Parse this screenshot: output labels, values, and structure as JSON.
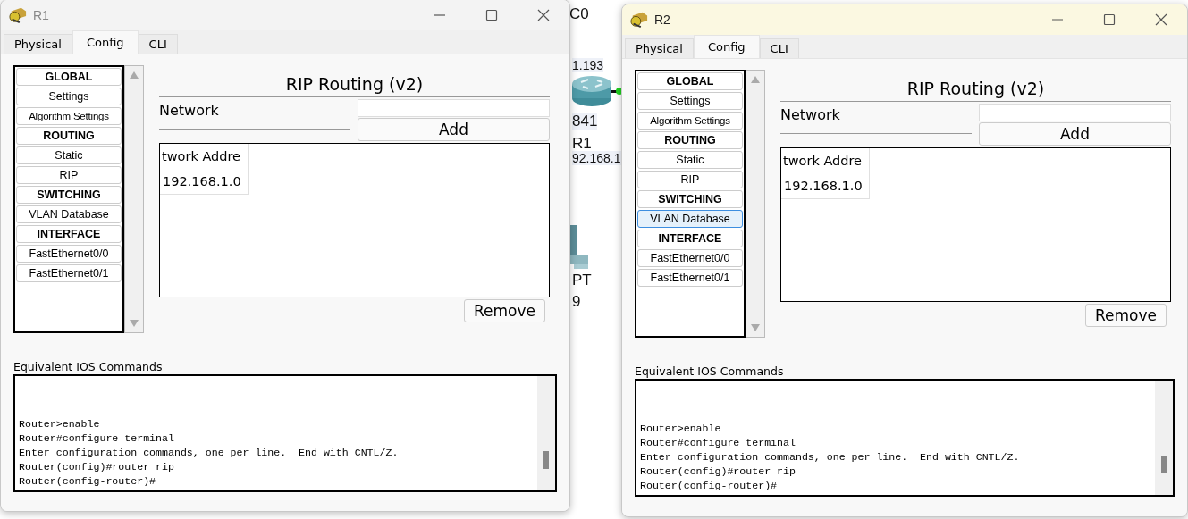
{
  "canvas_labels": [
    "C0",
    "1.193",
    "841",
    "R1",
    "92.168.1",
    "PT",
    "9"
  ],
  "windows": [
    {
      "title": "R1",
      "active": false,
      "tabs": [
        {
          "label": "Physical",
          "selected": false
        },
        {
          "label": "Config",
          "selected": true
        },
        {
          "label": "CLI",
          "selected": false
        }
      ],
      "sidebar": [
        {
          "label": "GLOBAL",
          "kind": "header",
          "selected": false
        },
        {
          "label": "Settings",
          "kind": "item",
          "selected": false
        },
        {
          "label": "Algorithm Settings",
          "kind": "item",
          "selected": false
        },
        {
          "label": "ROUTING",
          "kind": "header",
          "selected": false
        },
        {
          "label": "Static",
          "kind": "item",
          "selected": false
        },
        {
          "label": "RIP",
          "kind": "item",
          "selected": false
        },
        {
          "label": "SWITCHING",
          "kind": "header",
          "selected": false
        },
        {
          "label": "VLAN Database",
          "kind": "item",
          "selected": false
        },
        {
          "label": "INTERFACE",
          "kind": "header",
          "selected": false
        },
        {
          "label": "FastEthernet0/0",
          "kind": "item",
          "selected": false
        },
        {
          "label": "FastEthernet0/1",
          "kind": "item",
          "selected": false
        }
      ],
      "panel_title": "RIP Routing (v2)",
      "network_label": "Network",
      "add_button": "Add",
      "table": {
        "columns": [
          "twork Addre"
        ],
        "rows": [
          [
            "192.168.1.0"
          ]
        ]
      },
      "remove_button": "Remove",
      "commands_label": "Equivalent IOS Commands",
      "commands": [
        "Router>enable",
        "Router#configure terminal",
        "Enter configuration commands, one per line.  End with CNTL/Z.",
        "Router(config)#router rip",
        "Router(config-router)#"
      ]
    },
    {
      "title": "R2",
      "active": true,
      "tabs": [
        {
          "label": "Physical",
          "selected": false
        },
        {
          "label": "Config",
          "selected": true
        },
        {
          "label": "CLI",
          "selected": false
        }
      ],
      "sidebar": [
        {
          "label": "GLOBAL",
          "kind": "header",
          "selected": false
        },
        {
          "label": "Settings",
          "kind": "item",
          "selected": false
        },
        {
          "label": "Algorithm Settings",
          "kind": "item",
          "selected": false
        },
        {
          "label": "ROUTING",
          "kind": "header",
          "selected": false
        },
        {
          "label": "Static",
          "kind": "item",
          "selected": false
        },
        {
          "label": "RIP",
          "kind": "item",
          "selected": false
        },
        {
          "label": "SWITCHING",
          "kind": "header",
          "selected": false
        },
        {
          "label": "VLAN Database",
          "kind": "item",
          "selected": true
        },
        {
          "label": "INTERFACE",
          "kind": "header",
          "selected": false
        },
        {
          "label": "FastEthernet0/0",
          "kind": "item",
          "selected": false
        },
        {
          "label": "FastEthernet0/1",
          "kind": "item",
          "selected": false
        }
      ],
      "panel_title": "RIP Routing (v2)",
      "network_label": "Network",
      "add_button": "Add",
      "table": {
        "columns": [
          "twork Addre"
        ],
        "rows": [
          [
            "192.168.1.0"
          ]
        ]
      },
      "remove_button": "Remove",
      "commands_label": "Equivalent IOS Commands",
      "commands": [
        "Router>enable",
        "Router#configure terminal",
        "Enter configuration commands, one per line.  End with CNTL/Z.",
        "Router(config)#router rip",
        "Router(config-router)#"
      ]
    }
  ]
}
